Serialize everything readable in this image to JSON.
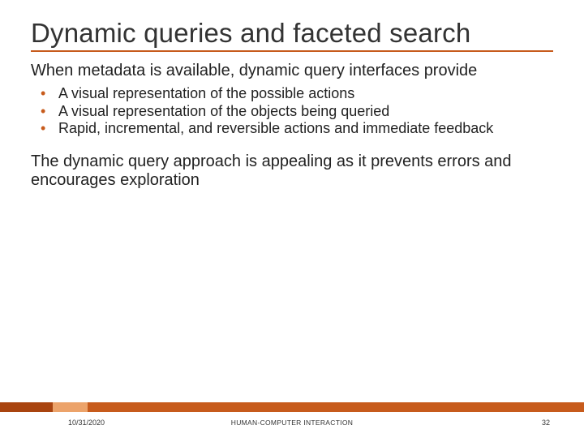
{
  "title": "Dynamic queries and faceted search",
  "lead": "When metadata is available, dynamic query interfaces provide",
  "bullets": [
    "A visual representation of the possible actions",
    "A visual representation of the objects being queried",
    "Rapid, incremental, and reversible actions and immediate feedback"
  ],
  "paragraph": "The dynamic query approach is appealing as it prevents errors and encourages exploration",
  "footer": {
    "date": "10/31/2020",
    "center": "HUMAN-COMPUTER INTERACTION",
    "page": "32"
  },
  "accent_color": "#c75b1c"
}
